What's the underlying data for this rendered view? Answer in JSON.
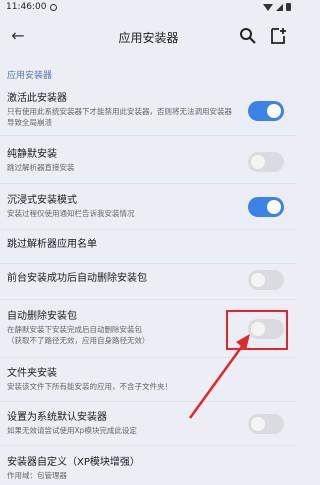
{
  "status_bar": {
    "time": "11:46:00"
  },
  "app_bar": {
    "title": "应用安装器"
  },
  "section_header": "应用安装器",
  "settings": [
    {
      "title": "激活此安装器",
      "subtitle": "只有使用此系统安装器下才能禁用此安装器，否则将无法调用安装器导致全局崩溃",
      "toggle": "on"
    },
    {
      "title": "纯静默安装",
      "subtitle": "跳过解析器直接安装",
      "toggle": "off"
    },
    {
      "title": "沉浸式安装模式",
      "subtitle": "安装过程仅使用通知栏告诉我安装情况",
      "toggle": "on"
    },
    {
      "title": "跳过解析器应用名单",
      "subtitle": "",
      "toggle": "none"
    },
    {
      "title": "前台安装成功后自动删除安装包",
      "subtitle": "",
      "toggle": "off"
    },
    {
      "title": "自动删除安装包",
      "subtitle": "在静默安装下安装完成后自动删除安装包",
      "subtitle2": "（获取不了路径无效，应用自身路径无效）",
      "toggle": "off"
    },
    {
      "title": "文件夹安装",
      "subtitle": "安装该文件下所有能安装的应用，不含子文件夹！",
      "toggle": "none"
    },
    {
      "title": "设置为系统默认安装器",
      "subtitle": "如果无效请尝试使用Xp模块完成此设定",
      "toggle": "off"
    },
    {
      "title": "安装器自定义（XP模块增强）",
      "subtitle": "作用域：包管理器",
      "toggle": "none"
    }
  ],
  "colors": {
    "accent": "#3b82e8",
    "section": "#5a76b8",
    "highlight": "#e3262b"
  }
}
